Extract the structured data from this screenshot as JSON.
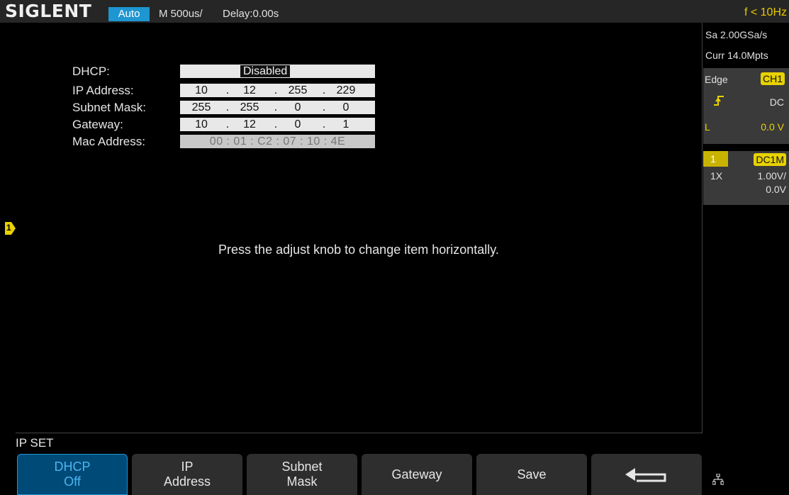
{
  "topbar": {
    "brand": "SIGLENT",
    "trigger_mode": "Auto",
    "timebase": "M 500us/",
    "delay": "Delay:0.00s",
    "frequency": "f < 10Hz"
  },
  "channel_marker": "1",
  "form": {
    "dhcp_label": "DHCP:",
    "dhcp_value": "Disabled",
    "ip_label": "IP Address:",
    "ip": [
      "10",
      "12",
      "255",
      "229"
    ],
    "subnet_label": "Subnet Mask:",
    "subnet": [
      "255",
      "255",
      "0",
      "0"
    ],
    "gateway_label": "Gateway:",
    "gateway": [
      "10",
      "12",
      "0",
      "1"
    ],
    "mac_label": "Mac Address:",
    "mac": "00 : 01 : C2 : 07 : 10 : 4E",
    "dot": "."
  },
  "hint": "Press the adjust knob to change item horizontally.",
  "right_panel": {
    "sample_rate": "Sa 2.00GSa/s",
    "memory": "Curr 14.0Mpts",
    "trigger_type": "Edge",
    "trigger_source": "CH1",
    "coupling": "DC",
    "level_label": "L",
    "level_value": "0.0 V",
    "channel_number": "1",
    "channel_coupling": "DC1M",
    "probe": "1X",
    "volts_div": "1.00V/",
    "offset": "0.0V"
  },
  "menu": {
    "title": "IP SET",
    "dhcp_label": "DHCP",
    "dhcp_value": "Off",
    "ip_label_1": "IP",
    "ip_label_2": "Address",
    "subnet_label_1": "Subnet",
    "subnet_label_2": "Mask",
    "gateway_label": "Gateway",
    "save_label": "Save"
  },
  "colors": {
    "accent_blue": "#1e96d2",
    "trigger_yellow": "#e8d200",
    "active_key": "#004a78"
  },
  "icons": {
    "back": "return-arrow-icon",
    "network": "network-icon",
    "trigger_edge": "rising-edge-icon"
  }
}
